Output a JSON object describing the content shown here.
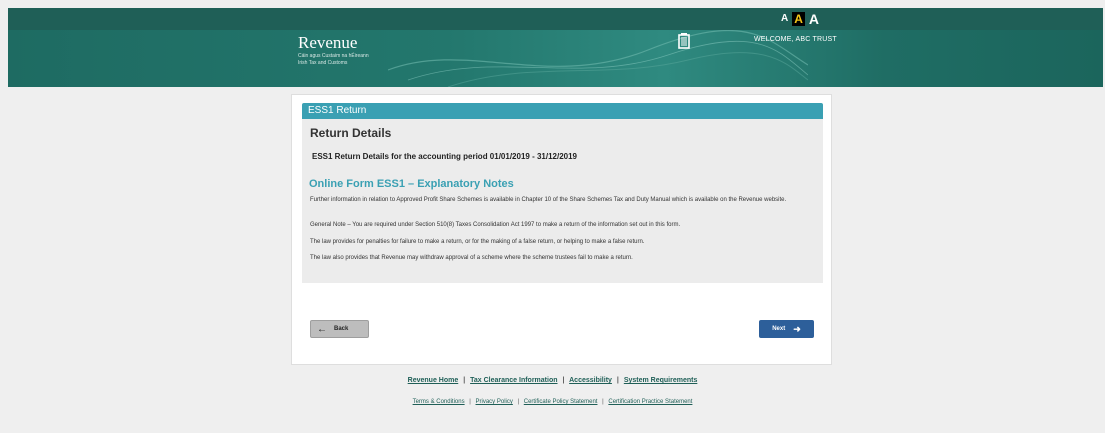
{
  "header": {
    "text_size": [
      "A",
      "A",
      "A"
    ],
    "logo_name": "Revenue",
    "logo_sub1": "Cáin agus Custaim na hÉireann",
    "logo_sub2": "Irish Tax and Customs",
    "welcome": "WELCOME, ABC TRUST"
  },
  "card": {
    "header": "ESS1 Return",
    "title": "Return Details",
    "period": "ESS1 Return Details for the accounting period 01/01/2019 - 31/12/2019",
    "notes_title": "Online Form ESS1 – Explanatory Notes",
    "paragraphs": [
      "Further information in relation to Approved Profit Share Schemes is available in Chapter 10 of the Share Schemes Tax and Duty Manual which is available on the Revenue website.",
      "General Note – You are required under Section 510(8) Taxes Consolidation Act 1997 to make a return of the information set out in this form.",
      "The law provides for penalties for failure to make a return, or for the making of a false return, or helping to make a false return.",
      "The law also provides that Revenue may withdraw approval of a scheme where the scheme trustees fail to make a return."
    ],
    "back_label": "Back",
    "next_label": "Next"
  },
  "footer": {
    "primary_links": [
      "Revenue Home",
      "Tax Clearance Information",
      "Accessibility",
      "System Requirements"
    ],
    "secondary_links": [
      "Terms & Conditions",
      "Privacy Policy",
      "Certificate Policy Statement",
      "Certification Practice Statement"
    ]
  },
  "colors": {
    "header_dark": "#1f5f57",
    "banner": "#23776d",
    "card_header": "#3aa0b3",
    "next_button": "#2d5f9a",
    "back_button": "#bdbdbd"
  }
}
